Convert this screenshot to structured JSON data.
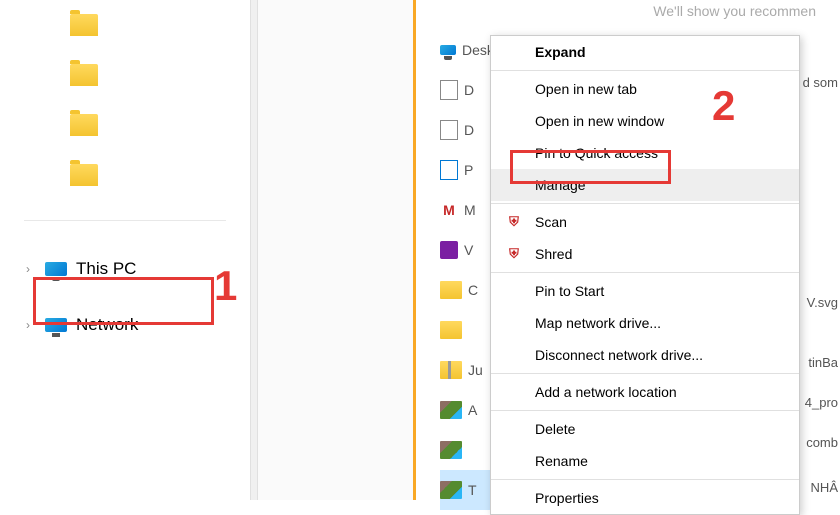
{
  "sidebar": {
    "nav": [
      {
        "label": "This PC",
        "icon": "monitor"
      },
      {
        "label": "Network",
        "icon": "network"
      }
    ]
  },
  "top_hint": "We'll show you recommen",
  "quick_items": [
    {
      "label": "Desktop",
      "icon": "monitor-sm"
    },
    {
      "label": "D",
      "icon": "file"
    },
    {
      "label": "D",
      "icon": "file"
    },
    {
      "label": "P",
      "icon": "file"
    },
    {
      "label": "M",
      "icon": "shield"
    },
    {
      "label": "V",
      "icon": "purple"
    },
    {
      "label": "C",
      "icon": "yellow-folder"
    },
    {
      "label": "",
      "icon": "yellow-folder"
    },
    {
      "label": "Ju",
      "icon": "zip-folder"
    },
    {
      "label": "A",
      "icon": "thumb"
    },
    {
      "label": "",
      "icon": "thumb"
    },
    {
      "label": "T",
      "icon": "thumb-sel"
    }
  ],
  "context_menu": {
    "expand": "Expand",
    "open_tab": "Open in new tab",
    "open_window": "Open in new window",
    "pin_quick": "Pin to Quick access",
    "manage": "Manage",
    "scan": "Scan",
    "shred": "Shred",
    "pin_start": "Pin to Start",
    "map_drive": "Map network drive...",
    "disconnect": "Disconnect network drive...",
    "add_location": "Add a network location",
    "delete": "Delete",
    "rename": "Rename",
    "properties": "Properties"
  },
  "right_texts": {
    "r1": "d som",
    "r2": "V.svg",
    "r3": "tinBa",
    "r4": "4_pro",
    "r5": "comb",
    "r6": "NHÂ"
  },
  "annotations": {
    "a1": "1",
    "a2": "2"
  }
}
